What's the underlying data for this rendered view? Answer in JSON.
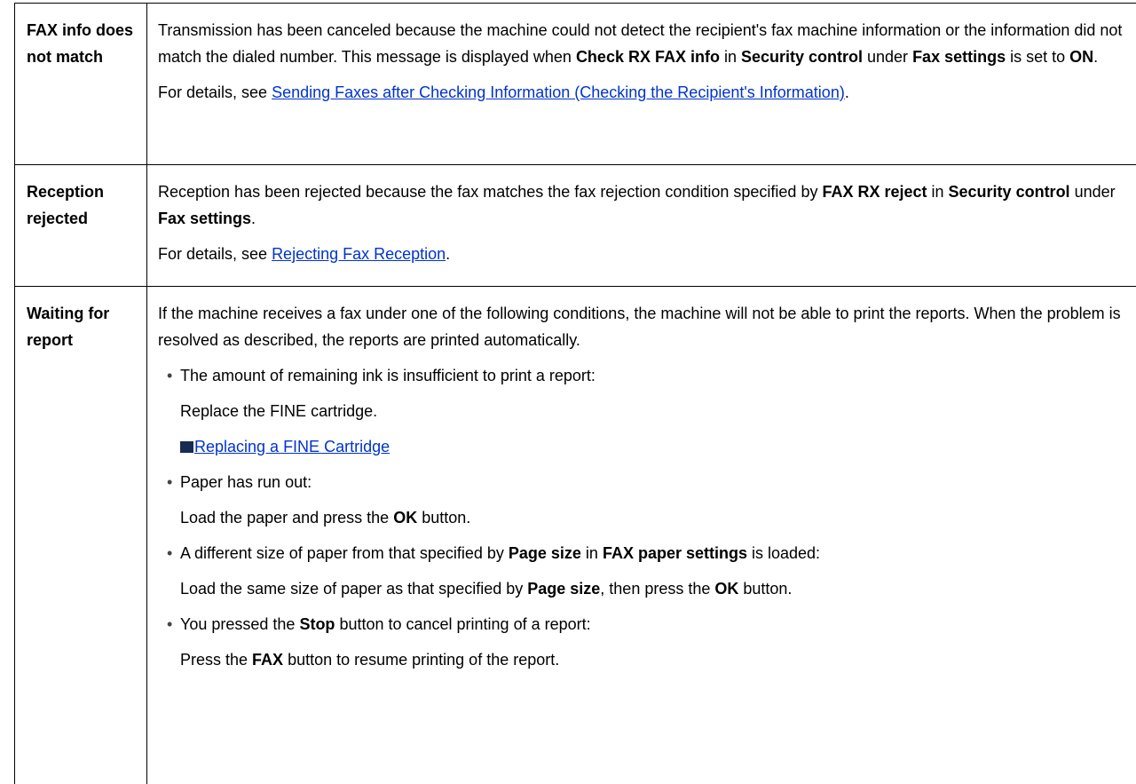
{
  "rows": [
    {
      "heading": "FAX info does not match",
      "p1": {
        "t1": "Transmission has been canceled because the machine could not detect the recipient's fax machine information or the information did not match the dialed number. This message is displayed when ",
        "b1": "Check RX FAX info",
        "t2": " in ",
        "b2": "Security control",
        "t3": " under ",
        "b3": "Fax settings",
        "t4": " is set to ",
        "b4": "ON",
        "t5": "."
      },
      "p2": {
        "prefix": "For details, see ",
        "link": "Sending Faxes after Checking Information (Checking the Recipient's Information)",
        "suffix": "."
      }
    },
    {
      "heading": "Reception rejected",
      "p1": {
        "t1": "Reception has been rejected because the fax matches the fax rejection condition specified by ",
        "b1": "FAX RX reject",
        "t2": " in ",
        "b2": "Security control",
        "t3": " under ",
        "b3": "Fax settings",
        "t4": "."
      },
      "p2": {
        "prefix": "For details, see ",
        "link": "Rejecting Fax Reception",
        "suffix": "."
      }
    },
    {
      "heading": "Waiting for report",
      "intro": "If the machine receives a fax under one of the following conditions, the machine will not be able to print the reports. When the problem is resolved as described, the reports are printed automatically.",
      "items": [
        {
          "bullet": "The amount of remaining ink is insufficient to print a report:",
          "action": "Replace the FINE cartridge.",
          "ref_link": "Replacing a FINE Cartridge",
          "ref_icon": "reference-arrow-icon"
        },
        {
          "bullet": "Paper has run out:",
          "action_t1": "Load the paper and press the ",
          "action_b1": "OK",
          "action_t2": " button."
        },
        {
          "bullet_t1": "A different size of paper from that specified by ",
          "bullet_b1": "Page size",
          "bullet_t2": " in ",
          "bullet_b2": "FAX paper settings",
          "bullet_t3": " is loaded:",
          "action_t1": "Load the same size of paper as that specified by ",
          "action_b1": "Page size",
          "action_t2": ", then press the ",
          "action_b2": "OK",
          "action_t3": " button."
        },
        {
          "bullet_t1": "You pressed the ",
          "bullet_b1": "Stop",
          "bullet_t2": " button to cancel printing of a report:",
          "action_t1": "Press the ",
          "action_b1": "FAX",
          "action_t2": " button to resume printing of the report."
        }
      ]
    }
  ]
}
